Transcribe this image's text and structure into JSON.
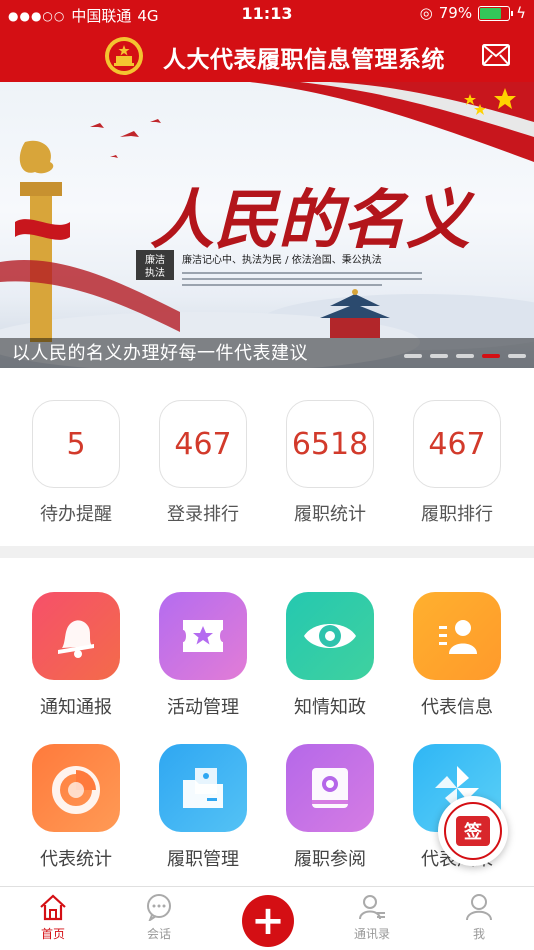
{
  "status_bar": {
    "carrier": "中国联通",
    "network": "4G",
    "time": "11:13",
    "battery": "79%",
    "battery_level": 0.79
  },
  "header": {
    "title": "人大代表履职信息管理系统"
  },
  "banner": {
    "headline": "人民的名义",
    "stamp_top": "廉洁",
    "stamp_bottom": "执法",
    "slogan": "廉洁记心中、执法为民 / 依法治国、秉公执法",
    "caption": "以人民的名义办理好每一件代表建议",
    "pages": 5,
    "active_page": 4
  },
  "stats": [
    {
      "value": "5",
      "label": "待办提醒"
    },
    {
      "value": "467",
      "label": "登录排行"
    },
    {
      "value": "6518",
      "label": "履职统计"
    },
    {
      "value": "467",
      "label": "履职排行"
    }
  ],
  "grid": [
    {
      "label": "通知通报",
      "icon": "bell-icon",
      "color_from": "#f6506a",
      "color_to": "#f36b4a"
    },
    {
      "label": "活动管理",
      "icon": "ticket-star-icon",
      "color_from": "#b46cf0",
      "color_to": "#e27cd6"
    },
    {
      "label": "知情知政",
      "icon": "eye-icon",
      "color_from": "#25c8b0",
      "color_to": "#3fd19f"
    },
    {
      "label": "代表信息",
      "icon": "id-card-icon",
      "color_from": "#ffb02e",
      "color_to": "#ff9a2b"
    },
    {
      "label": "代表统计",
      "icon": "pie-chart-icon",
      "color_from": "#ff7a3c",
      "color_to": "#ff9a55"
    },
    {
      "label": "履职管理",
      "icon": "folder-icon",
      "color_from": "#2fa7f2",
      "color_to": "#54c2f5"
    },
    {
      "label": "履职参阅",
      "icon": "book-icon",
      "color_from": "#b568e9",
      "color_to": "#d57ce3"
    },
    {
      "label": "代表风采",
      "icon": "pinwheel-icon",
      "color_from": "#2fb6f5",
      "color_to": "#5cd0f7"
    }
  ],
  "floating_button": {
    "label": "签"
  },
  "tabbar": [
    {
      "label": "首页",
      "icon": "home-icon",
      "active": true
    },
    {
      "label": "会话",
      "icon": "chat-icon",
      "active": false
    },
    {
      "label": "",
      "icon": "plus-icon",
      "active": false
    },
    {
      "label": "通讯录",
      "icon": "contacts-icon",
      "active": false
    },
    {
      "label": "我",
      "icon": "profile-icon",
      "active": false
    }
  ]
}
